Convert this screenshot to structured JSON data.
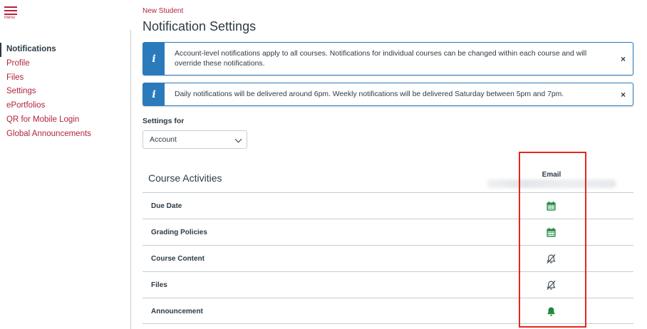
{
  "header": {
    "menu_label": "menu"
  },
  "sidebar": {
    "items": [
      {
        "label": "Notifications",
        "active": true
      },
      {
        "label": "Profile"
      },
      {
        "label": "Files"
      },
      {
        "label": "Settings"
      },
      {
        "label": "ePortfolios"
      },
      {
        "label": "QR for Mobile Login"
      },
      {
        "label": "Global Announcements"
      }
    ]
  },
  "main": {
    "breadcrumb": "New Student",
    "title": "Notification Settings",
    "alerts": [
      {
        "icon": "info-icon",
        "glyph": "i",
        "text": "Account-level notifications apply to all courses. Notifications for individual courses can be changed within each course and will override these notifications.",
        "close": "×"
      },
      {
        "icon": "info-icon",
        "glyph": "i",
        "text": "Daily notifications will be delivered around 6pm. Weekly notifications will be delivered Saturday between 5pm and 7pm.",
        "close": "×"
      }
    ],
    "settings_for_label": "Settings for",
    "settings_for_value": "Account",
    "section_title": "Course Activities",
    "column_email": "Email",
    "rows": [
      {
        "label": "Due Date",
        "icon": "calendar-icon",
        "state": "weekly"
      },
      {
        "label": "Grading Policies",
        "icon": "calendar-icon",
        "state": "weekly"
      },
      {
        "label": "Course Content",
        "icon": "bell-off-icon",
        "state": "off"
      },
      {
        "label": "Files",
        "icon": "bell-off-icon",
        "state": "off"
      },
      {
        "label": "Announcement",
        "icon": "bell-icon",
        "state": "immediately"
      }
    ]
  },
  "colors": {
    "brand": "#b2243b",
    "info": "#2b7abc",
    "on": "#1f8a3e",
    "text": "#2d3b45",
    "highlight": "#e3281c"
  }
}
